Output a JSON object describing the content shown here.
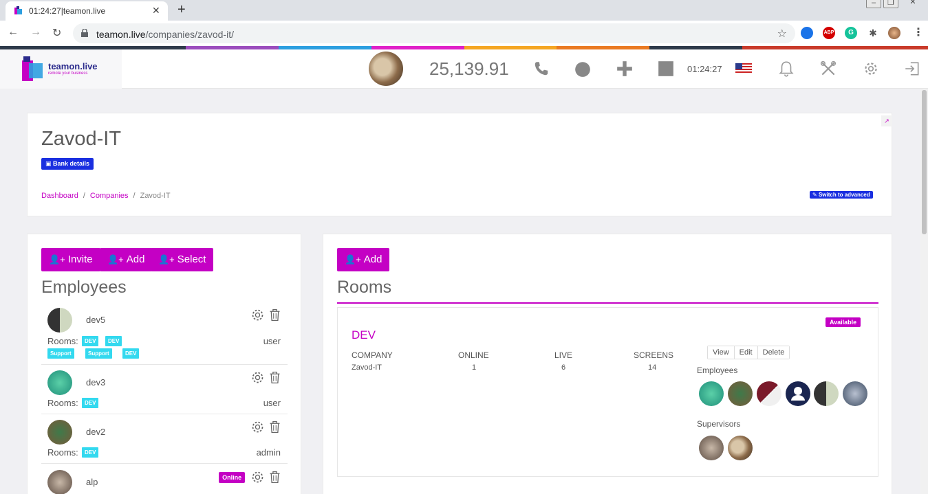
{
  "browser": {
    "tab_title": "01:24:27|teamon.live",
    "url_host": "teamon.live",
    "url_path": "/companies/zavod-it/",
    "ext_abp": "ABP",
    "ext_g": "G"
  },
  "header": {
    "logo_name": "teamon.live",
    "logo_tagline": "remote your business",
    "balance": "25,139.91",
    "time": "01:24:27",
    "icons": [
      "phone-icon",
      "record-icon",
      "plus-icon",
      "stop-icon",
      "flag-icon",
      "bell-icon",
      "tools-icon",
      "gear-icon",
      "logout-icon"
    ]
  },
  "company": {
    "title": "Zavod-IT",
    "bank_details_label": "Bank details",
    "switch_label": "Switch to advanced",
    "breadcrumb": [
      "Dashboard",
      "Companies",
      "Zavod-IT"
    ]
  },
  "employees": {
    "buttons": [
      "Invite",
      "Add",
      "Select"
    ],
    "title": "Employees",
    "rooms_label": "Rooms:",
    "online_label": "Online",
    "list": [
      {
        "name": "dev5",
        "role": "user",
        "rooms": [
          "DEV",
          "DEV",
          "Support",
          "Support",
          "DEV"
        ]
      },
      {
        "name": "dev3",
        "role": "user",
        "rooms": [
          "DEV"
        ]
      },
      {
        "name": "dev2",
        "role": "admin",
        "rooms": [
          "DEV"
        ]
      },
      {
        "name": "alp",
        "role": "",
        "rooms": []
      }
    ]
  },
  "rooms": {
    "add_label": "Add",
    "title": "Rooms",
    "room": {
      "name": "DEV",
      "status": "Available",
      "stats": [
        {
          "label": "COMPANY",
          "value": "Zavod-IT"
        },
        {
          "label": "ONLINE",
          "value": "1"
        },
        {
          "label": "LIVE",
          "value": "6"
        },
        {
          "label": "SCREENS",
          "value": "14"
        }
      ],
      "actions": [
        "View",
        "Edit",
        "Delete"
      ],
      "employees_label": "Employees",
      "supervisors_label": "Supervisors"
    }
  },
  "colors": {
    "accent": "#c400c4",
    "primary_blue": "#1a2fe0",
    "tag_cyan": "#33d9ef",
    "strip": [
      "#2e3a4a",
      "#2e3a4a",
      "#9b4dbd",
      "#2d9fe0",
      "#e020c8",
      "#f5a623",
      "#ea7a22",
      "#2e3a4a",
      "#c93a2a",
      "#c93a2a"
    ]
  }
}
